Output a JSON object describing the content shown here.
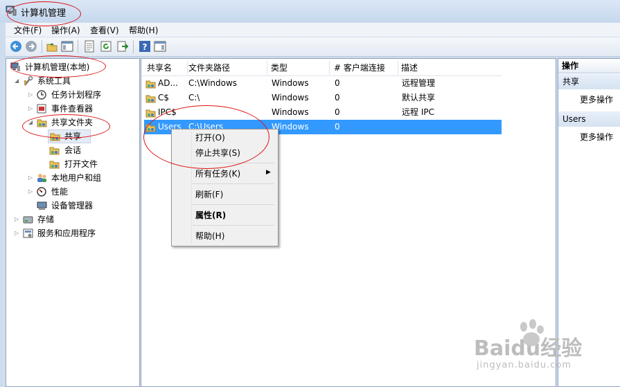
{
  "window": {
    "title": "计算机管理"
  },
  "menu": [
    "文件(F)",
    "操作(A)",
    "查看(V)",
    "帮助(H)"
  ],
  "tree": {
    "root": "计算机管理(本地)",
    "system_tools": "系统工具",
    "task_scheduler": "任务计划程序",
    "event_viewer": "事件查看器",
    "shared_folders": "共享文件夹",
    "shares": "共享",
    "sessions": "会话",
    "open_files": "打开文件",
    "local_users": "本地用户和组",
    "performance": "性能",
    "device_manager": "设备管理器",
    "storage": "存储",
    "services_apps": "服务和应用程序"
  },
  "list": {
    "headers": [
      "共享名",
      "文件夹路径",
      "类型",
      "# 客户端连接",
      "描述"
    ],
    "rows": [
      {
        "name": "AD...",
        "path": "C:\\Windows",
        "type": "Windows",
        "clients": "0",
        "desc": "远程管理"
      },
      {
        "name": "C$",
        "path": "C:\\",
        "type": "Windows",
        "clients": "0",
        "desc": "默认共享"
      },
      {
        "name": "IPC$",
        "path": "",
        "type": "Windows",
        "clients": "0",
        "desc": "远程 IPC"
      },
      {
        "name": "Users",
        "path": "C:\\Users",
        "type": "Windows",
        "clients": "0",
        "desc": ""
      }
    ]
  },
  "actions": {
    "title": "操作",
    "section1": "共享",
    "more1": "更多操作",
    "section2": "Users",
    "more2": "更多操作"
  },
  "context_menu": {
    "open": "打开(O)",
    "stop_sharing": "停止共享(S)",
    "all_tasks": "所有任务(K)",
    "refresh": "刷新(F)",
    "properties": "属性(R)",
    "help": "帮助(H)"
  },
  "watermark": {
    "brand": "Baidu经验",
    "url": "jingyan.baidu.com"
  },
  "colors": {
    "selection": "#3399ff",
    "annotation": "#dd1111",
    "window_frame": "#cfdced"
  }
}
